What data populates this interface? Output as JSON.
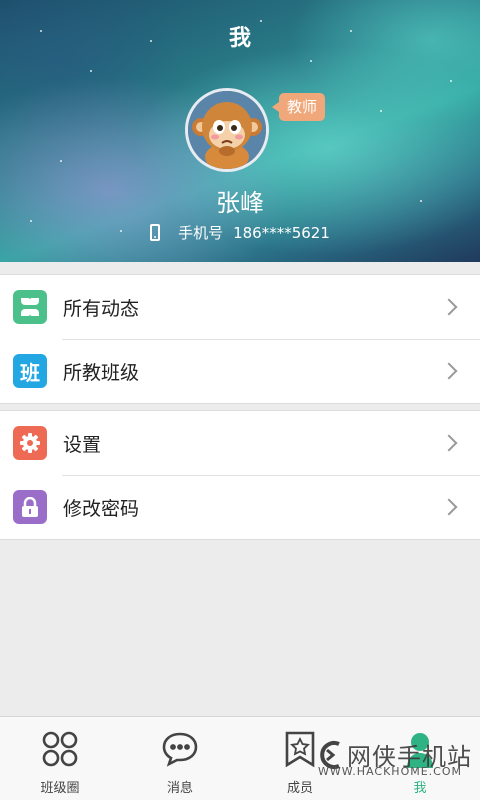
{
  "header": {
    "title": "我",
    "role_badge": "教师",
    "user_name": "张峰",
    "phone_label": "手机号",
    "phone_number": "186****5621"
  },
  "menu_groups": [
    [
      {
        "label": "所有动态",
        "icon": "grid-petals-icon",
        "color": "#4cc08a"
      },
      {
        "label": "所教班级",
        "icon": "class-badge-icon",
        "icon_text": "班",
        "color": "#23a7e3"
      }
    ],
    [
      {
        "label": "设置",
        "icon": "gear-icon",
        "color": "#ef6a55"
      },
      {
        "label": "修改密码",
        "icon": "lock-icon",
        "color": "#9a6ec8"
      }
    ]
  ],
  "tabbar": [
    {
      "label": "班级圈",
      "icon": "circles-grid-icon"
    },
    {
      "label": "消息",
      "icon": "chat-bubble-icon"
    },
    {
      "label": "成员",
      "icon": "star-book-icon"
    },
    {
      "label": "我",
      "icon": "person-icon",
      "active": true
    }
  ],
  "watermark": {
    "cn": "网侠手机站",
    "en": "WWW.HACKHOME.COM"
  },
  "colors": {
    "accent": "#2fb384",
    "badge": "#f0a87a"
  }
}
